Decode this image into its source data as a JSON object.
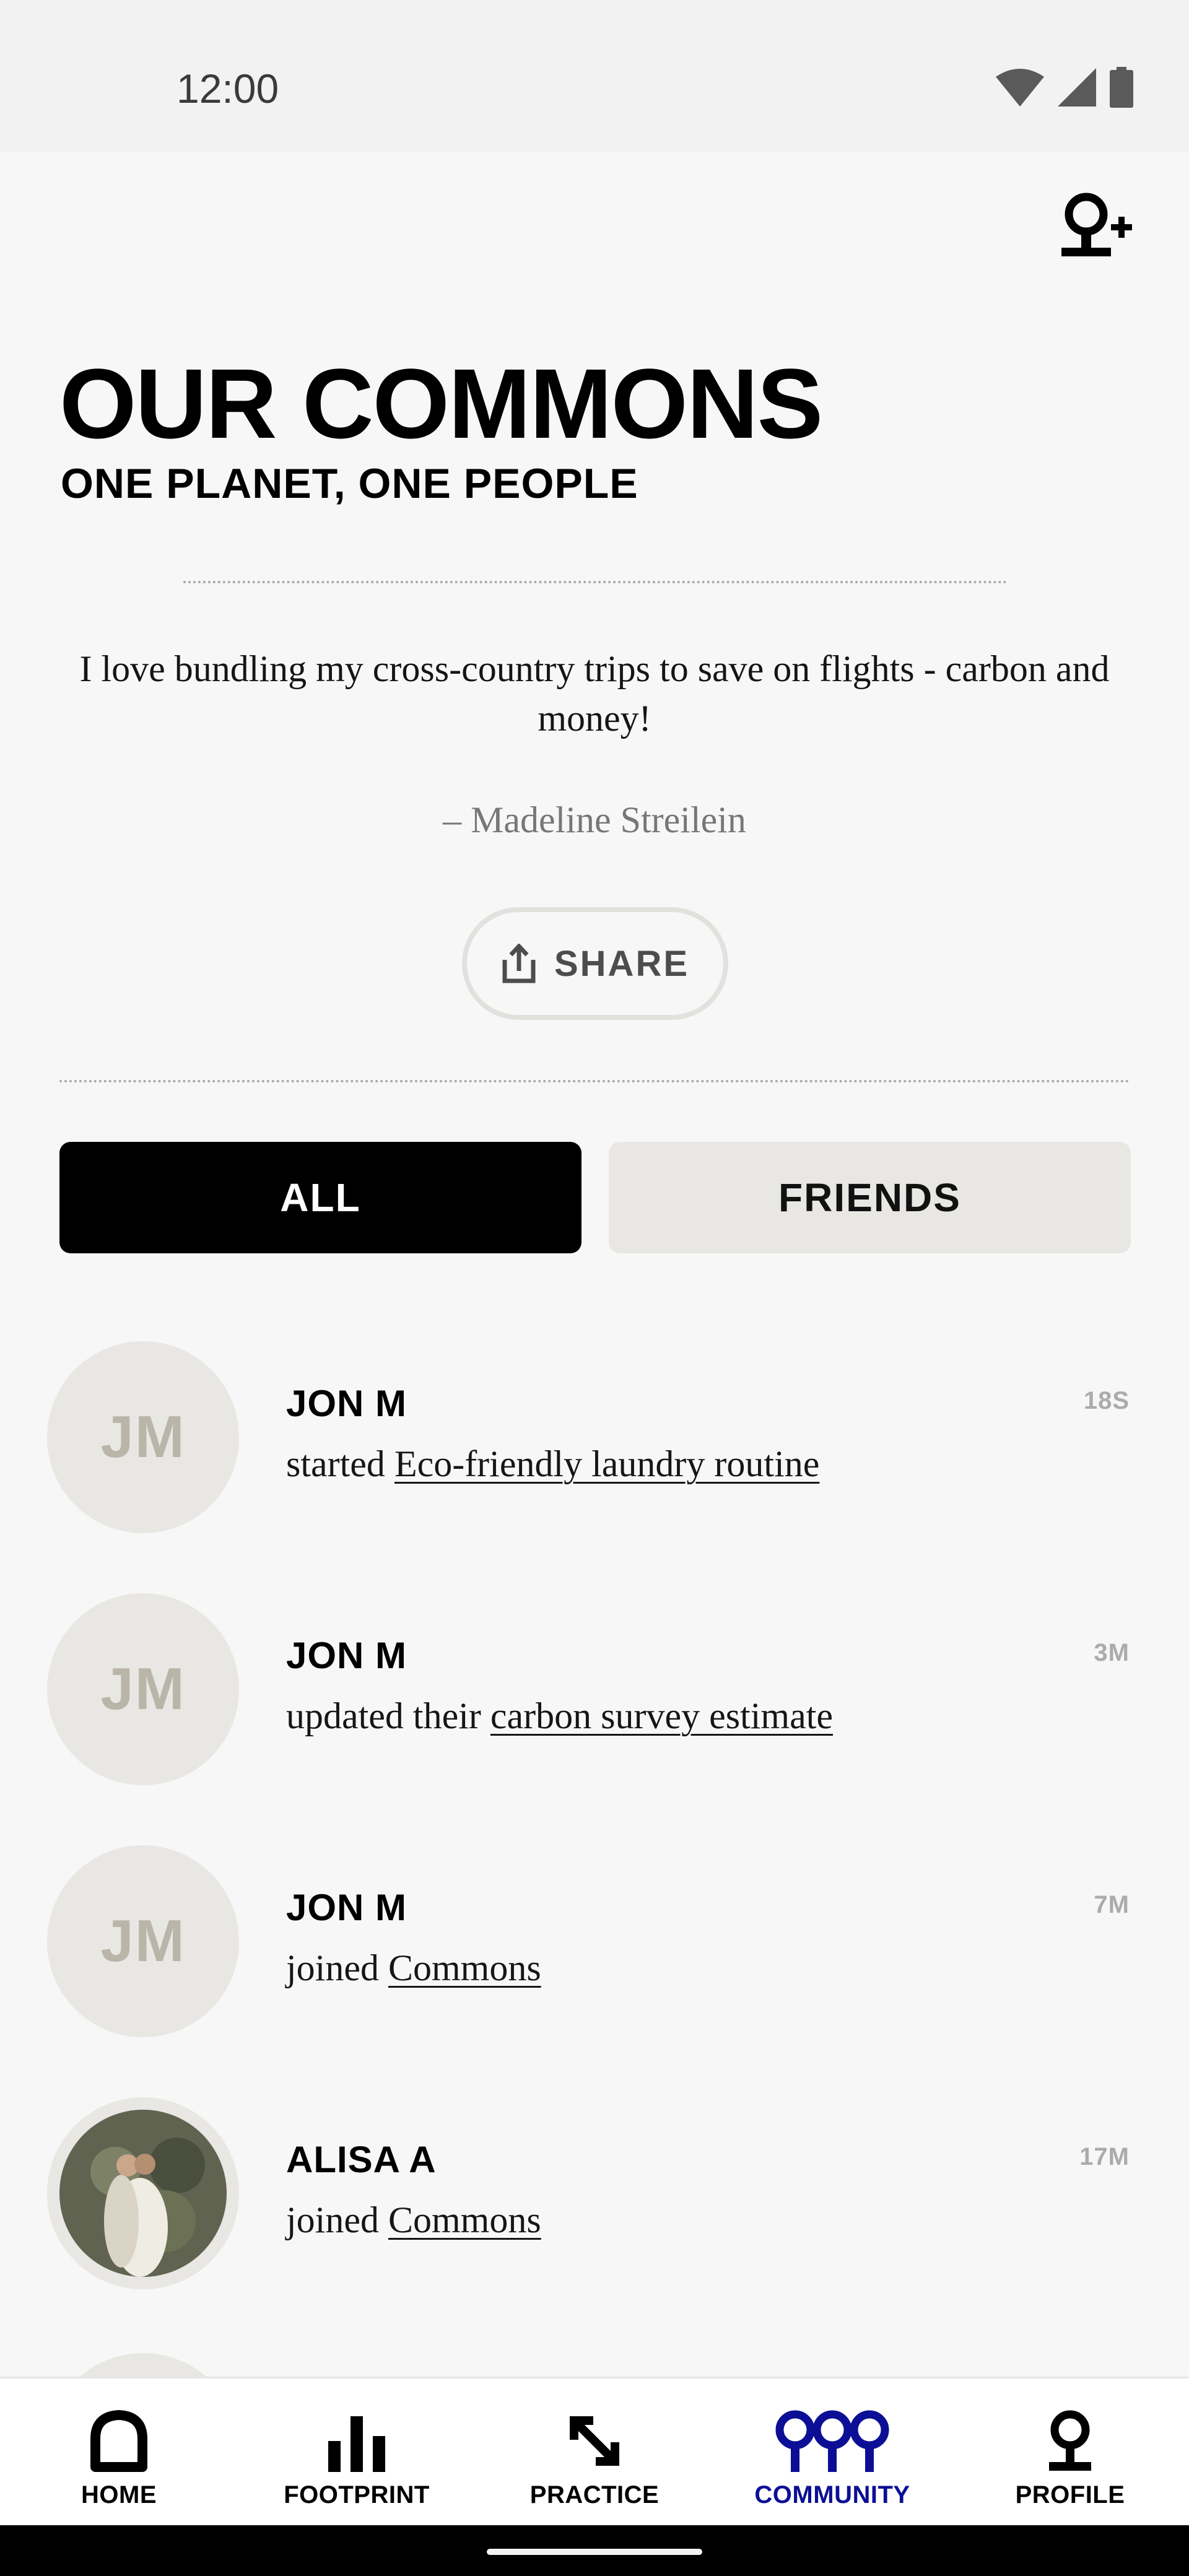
{
  "status_bar": {
    "time": "12:00"
  },
  "header": {
    "title": "OUR COMMONS",
    "subtitle": "ONE PLANET, ONE PEOPLE"
  },
  "quote": {
    "text": "I love bundling my cross-country trips to save on flights - carbon and money!",
    "author": "– Madeline Streilein"
  },
  "share_label": "SHARE",
  "tabs": [
    {
      "label": "ALL",
      "active": true
    },
    {
      "label": "FRIENDS",
      "active": false
    }
  ],
  "feed": [
    {
      "initials": "JM",
      "name": "JON M",
      "time": "18S",
      "action": "started",
      "link": "Eco-friendly laundry routine",
      "has_photo": false
    },
    {
      "initials": "JM",
      "name": "JON M",
      "time": "3M",
      "action": "updated their",
      "link": "carbon survey estimate",
      "has_photo": false
    },
    {
      "initials": "JM",
      "name": "JON M",
      "time": "7M",
      "action": "joined",
      "link": "Commons",
      "has_photo": false
    },
    {
      "initials": "",
      "name": "ALISA A",
      "time": "17M",
      "action": "joined",
      "link": "Commons",
      "has_photo": true
    }
  ],
  "bottom_nav": [
    {
      "label": "HOME",
      "icon": "home-icon",
      "active": false
    },
    {
      "label": "FOOTPRINT",
      "icon": "bar-chart-icon",
      "active": false
    },
    {
      "label": "PRACTICE",
      "icon": "arrows-diagonal-icon",
      "active": false
    },
    {
      "label": "COMMUNITY",
      "icon": "community-icon",
      "active": true
    },
    {
      "label": "PROFILE",
      "icon": "person-icon",
      "active": false
    }
  ],
  "colors": {
    "accent": "#0c0f95",
    "background": "#f7f7f7",
    "tab_inactive": "#e8e7e3",
    "avatar_bg": "#e8e7e3",
    "avatar_text": "#b9b5a9"
  }
}
